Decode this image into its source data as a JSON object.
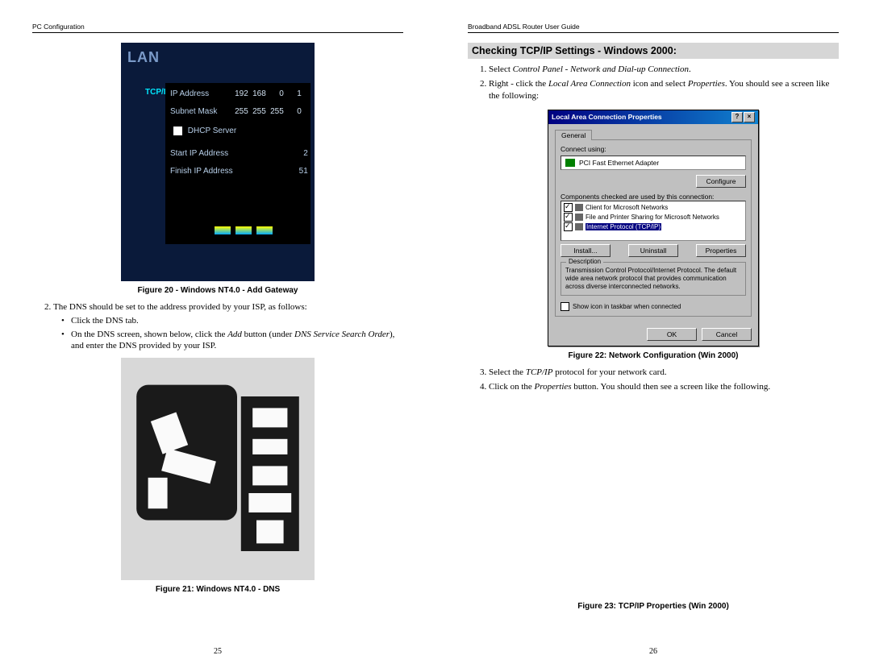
{
  "left": {
    "header": "PC Configuration",
    "pageno": "25",
    "lan": {
      "title": "LAN",
      "tcpip": "TCP/IP",
      "rows": {
        "ip_label": "IP Address",
        "ip_val": [
          "192",
          "168",
          "0",
          "1"
        ],
        "mask_label": "Subnet Mask",
        "mask_val": [
          "255",
          "255",
          "255",
          "0"
        ],
        "dhcp_label": "DHCP Server",
        "start_label": "Start IP Address",
        "start_val": [
          "",
          "",
          "",
          "2"
        ],
        "finish_label": "Finish IP Address",
        "finish_val": [
          "",
          "",
          "",
          "51"
        ]
      }
    },
    "fig20": "Figure 20 - Windows NT4.0 - Add Gateway",
    "step2": "The DNS should be set to the address provided by your ISP, as follows:",
    "bul1": "Click the DNS tab.",
    "bul2a": "On the DNS screen, shown below, click the ",
    "bul2_add": "Add",
    "bul2b": " button (under ",
    "bul2_dns": "DNS Service Search Order",
    "bul2c": "), and enter the DNS provided by your ISP.",
    "fig21": "Figure 21: Windows NT4.0 - DNS"
  },
  "right": {
    "header": "Broadband ADSL Router User Guide",
    "pageno": "26",
    "heading": "Checking TCP/IP Settings - Windows 2000:",
    "s1a": "Select ",
    "s1_i": "Control Panel - Network and Dial-up Connection",
    "s1b": ".",
    "s2a": "Right - click the ",
    "s2_i1": "Local Area Connection",
    "s2b": " icon and select ",
    "s2_i2": "Properties",
    "s2c": ". You should see a screen like the following:",
    "fig22": "Figure 22: Network Configuration (Win 2000)",
    "s3a": "Select the ",
    "s3_i": "TCP/IP",
    "s3b": " protocol for your network card.",
    "s4a": "Click on the ",
    "s4_i": "Properties",
    "s4b": " button. You should then see a screen like the following.",
    "fig23": "Figure 23: TCP/IP Properties (Win 2000)",
    "dlg": {
      "title": "Local Area Connection Properties",
      "tab": "General",
      "connect_using": "Connect using:",
      "adapter": "PCI Fast Ethernet Adapter",
      "configure": "Configure",
      "components": "Components checked are used by this connection:",
      "items": [
        "Client for Microsoft Networks",
        "File and Printer Sharing for Microsoft Networks",
        "Internet Protocol (TCP/IP)"
      ],
      "install": "Install...",
      "uninstall": "Uninstall",
      "properties": "Properties",
      "desc_label": "Description",
      "desc_text": "Transmission Control Protocol/Internet Protocol. The default wide area network protocol that provides communication across diverse interconnected networks.",
      "show_icon": "Show icon in taskbar when connected",
      "ok": "OK",
      "cancel": "Cancel"
    }
  }
}
